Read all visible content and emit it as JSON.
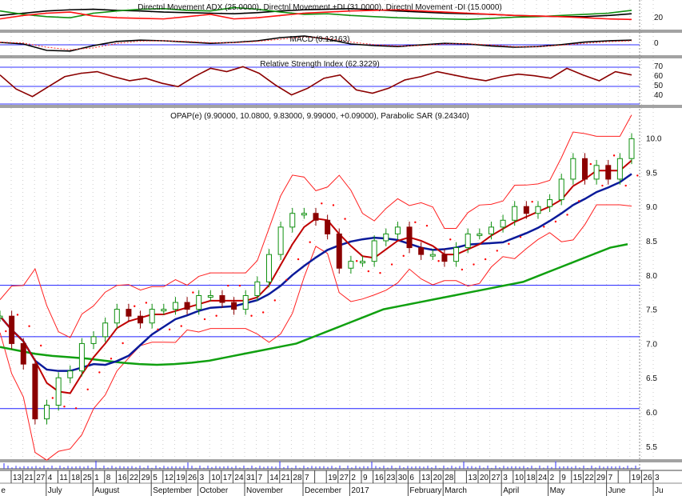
{
  "chart_data": [
    {
      "type": "line",
      "title": "Directnl Movement ADX (25.0000), Directnl Movement +DI (31.0000), Directnl Movement -DI (15.0000)",
      "yticks": [
        20
      ],
      "ylim": [
        0,
        45
      ],
      "series": [
        {
          "name": "ADX",
          "color": "#000000",
          "values": [
            22,
            26,
            30,
            32,
            33,
            31,
            30,
            28,
            27,
            26,
            25,
            27,
            30,
            32,
            33,
            34,
            32,
            30,
            28,
            26,
            25,
            24,
            22,
            21,
            20,
            20,
            22,
            25
          ]
        },
        {
          "name": "+DI",
          "color": "#109010",
          "values": [
            30,
            24,
            20,
            18,
            26,
            30,
            33,
            34,
            31,
            30,
            36,
            33,
            28,
            24,
            25,
            22,
            20,
            18,
            17,
            16,
            15,
            17,
            19,
            20,
            22,
            24,
            26,
            31
          ]
        },
        {
          "name": "-DI",
          "color": "#ff1010",
          "values": [
            16,
            22,
            26,
            28,
            21,
            18,
            17,
            16,
            20,
            24,
            16,
            18,
            22,
            26,
            28,
            30,
            31,
            32,
            30,
            28,
            26,
            24,
            22,
            21,
            20,
            18,
            16,
            15
          ]
        }
      ]
    },
    {
      "type": "line",
      "title": "MACD (0.12163)",
      "yticks": [
        0
      ],
      "ylim": [
        -0.3,
        0.3
      ],
      "series": [
        {
          "name": "MACD",
          "color": "#000000",
          "values": [
            0.05,
            0.0,
            -0.2,
            -0.22,
            -0.05,
            0.08,
            0.12,
            0.1,
            0.06,
            0.02,
            0.05,
            0.1,
            0.2,
            0.25,
            0.15,
            0.0,
            -0.05,
            -0.08,
            -0.03,
            0.02,
            0.0,
            -0.06,
            -0.1,
            -0.08,
            -0.02,
            0.06,
            0.1,
            0.12
          ]
        },
        {
          "name": "Signal",
          "color": "#ff3030",
          "values": [
            0.06,
            0.03,
            -0.1,
            -0.18,
            -0.12,
            0.02,
            0.09,
            0.1,
            0.08,
            0.04,
            0.04,
            0.08,
            0.15,
            0.22,
            0.18,
            0.06,
            -0.02,
            -0.06,
            -0.05,
            0.0,
            0.01,
            -0.03,
            -0.08,
            -0.08,
            -0.04,
            0.02,
            0.07,
            0.1
          ]
        }
      ]
    },
    {
      "type": "line",
      "title": "Relative Strength Index (62.3229)",
      "yticks": [
        70,
        60,
        50,
        40
      ],
      "ylim": [
        28,
        80
      ],
      "series": [
        {
          "name": "RSI",
          "color": "#8b0000",
          "values": [
            62,
            45,
            36,
            48,
            60,
            64,
            66,
            60,
            55,
            58,
            52,
            48,
            60,
            70,
            66,
            72,
            64,
            50,
            38,
            46,
            58,
            62,
            44,
            40,
            46,
            56,
            60,
            66,
            62,
            58,
            55,
            60,
            63,
            61,
            58,
            70,
            62,
            55,
            66,
            62
          ]
        }
      ]
    },
    {
      "type": "line",
      "title": "OPAP(e) (9.90000, 10.0800, 9.83000, 9.99000, +0.09000), Parabolic SAR (9.24340)",
      "ylim": [
        5.3,
        10.45
      ],
      "yticks": [
        "10.0",
        "9.5",
        "9.0",
        "8.5",
        "8.0",
        "7.5",
        "7.0",
        "6.5",
        "6.0",
        "5.5"
      ],
      "hlines": [
        7.85,
        7.1,
        6.05
      ],
      "closes": [
        7.4,
        7.0,
        6.7,
        5.9,
        6.1,
        6.5,
        6.6,
        7.0,
        7.1,
        7.3,
        7.5,
        7.4,
        7.3,
        7.5,
        7.5,
        7.6,
        7.5,
        7.7,
        7.7,
        7.6,
        7.5,
        7.7,
        7.9,
        8.3,
        8.7,
        8.9,
        8.9,
        8.8,
        8.6,
        8.1,
        8.2,
        8.2,
        8.5,
        8.6,
        8.7,
        8.4,
        8.3,
        8.3,
        8.2,
        8.4,
        8.6,
        8.6,
        8.7,
        8.8,
        9.0,
        8.9,
        9.0,
        9.1,
        9.4,
        9.7,
        9.4,
        9.6,
        9.4,
        9.7,
        9.99
      ],
      "ma_long": [
        6.95,
        6.9,
        6.85,
        6.82,
        6.8,
        6.78,
        6.75,
        6.72,
        6.7,
        6.69,
        6.7,
        6.72,
        6.75,
        6.8,
        6.85,
        6.9,
        6.95,
        7.0,
        7.1,
        7.2,
        7.3,
        7.4,
        7.5,
        7.55,
        7.6,
        7.65,
        7.7,
        7.75,
        7.8,
        7.85,
        7.9,
        8.0,
        8.1,
        8.2,
        8.3,
        8.4,
        8.45
      ],
      "x_day_labels": [
        "13",
        "21",
        "27",
        "4",
        "11",
        "18",
        "25",
        "1",
        "8",
        "16",
        "22",
        "29",
        "5",
        "12",
        "19",
        "26",
        "3",
        "10",
        "17",
        "24",
        "31",
        "7",
        "14",
        "21",
        "28",
        "7",
        "",
        "19",
        "27",
        "2",
        "9",
        "16",
        "23",
        "30",
        "6",
        "13",
        "20",
        "28",
        "",
        "13",
        "20",
        "27",
        "3",
        "10",
        "18",
        "24",
        "2",
        "9",
        "15",
        "22",
        "29",
        "7",
        "",
        "19",
        "26",
        "3"
      ],
      "x_months": [
        {
          "label": "e",
          "slot": -1
        },
        {
          "label": "July",
          "slot": 3
        },
        {
          "label": "August",
          "slot": 7
        },
        {
          "label": "September",
          "slot": 12
        },
        {
          "label": "October",
          "slot": 16
        },
        {
          "label": "November",
          "slot": 20
        },
        {
          "label": "December",
          "slot": 25
        },
        {
          "label": "2017",
          "slot": 29
        },
        {
          "label": "February",
          "slot": 34
        },
        {
          "label": "March",
          "slot": 37
        },
        {
          "label": "April",
          "slot": 42
        },
        {
          "label": "May",
          "slot": 46
        },
        {
          "label": "June",
          "slot": 51
        },
        {
          "label": "Ju",
          "slot": 55
        }
      ]
    }
  ]
}
